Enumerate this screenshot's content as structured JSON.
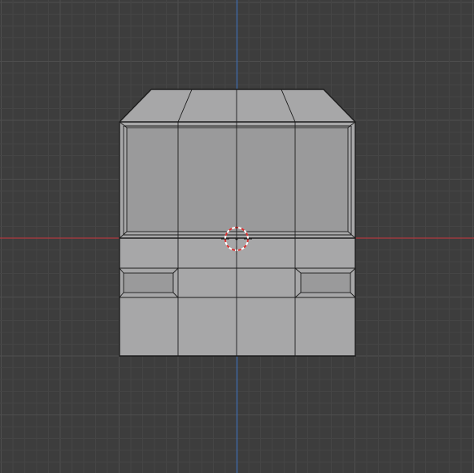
{
  "viewport": {
    "view": "front-orthographic",
    "background_color": "#3d3d3d",
    "grid_minor_color": "#454545",
    "grid_major_color": "#4e4e4e",
    "x_axis_color": "#b1393f",
    "z_axis_color": "#3f6eb5"
  },
  "mesh": {
    "face_color": "#a7a7a8",
    "face_dark_color": "#9a9a9b",
    "edge_color": "#1d1d1d"
  },
  "cursor_3d": {
    "ring_color_a": "#ffffff",
    "ring_color_b": "#d62f2f"
  }
}
